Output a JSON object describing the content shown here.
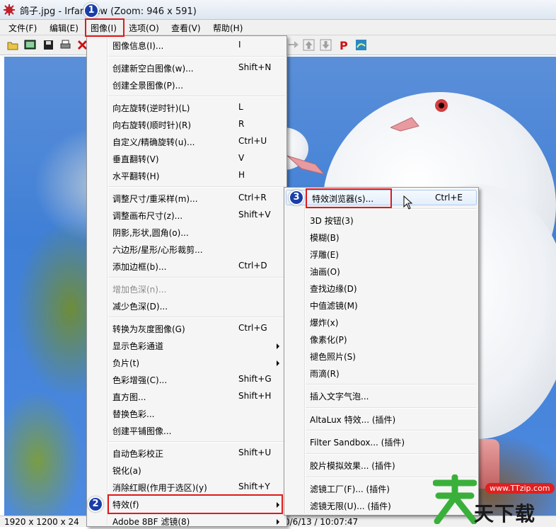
{
  "window": {
    "title": "鸽子.jpg - IrfanView (Zoom: 946 x 591)"
  },
  "menubar": {
    "items": [
      "文件(F)",
      "编辑(E)",
      "图像(I)",
      "选项(O)",
      "查看(V)",
      "帮助(H)"
    ]
  },
  "image_menu": {
    "items": [
      {
        "label": "图像信息(I)...",
        "shortcut": "I"
      },
      {
        "label": "创建新空白图像(w)...",
        "shortcut": "Shift+N"
      },
      {
        "label": "创建全景图像(P)...",
        "shortcut": ""
      },
      {
        "label": "向左旋转(逆时针)(L)",
        "shortcut": "L"
      },
      {
        "label": "向右旋转(顺时针)(R)",
        "shortcut": "R"
      },
      {
        "label": "自定义/精确旋转(u)...",
        "shortcut": "Ctrl+U"
      },
      {
        "label": "垂直翻转(V)",
        "shortcut": "V"
      },
      {
        "label": "水平翻转(H)",
        "shortcut": "H"
      },
      {
        "label": "调整尺寸/重采样(m)...",
        "shortcut": "Ctrl+R"
      },
      {
        "label": "调整画布尺寸(z)...",
        "shortcut": "Shift+V"
      },
      {
        "label": "阴影,形状,圆角(o)...",
        "shortcut": ""
      },
      {
        "label": "六边形/星形/心形裁剪...",
        "shortcut": ""
      },
      {
        "label": "添加边框(b)...",
        "shortcut": "Ctrl+D"
      },
      {
        "label": "增加色深(n)...",
        "shortcut": ""
      },
      {
        "label": "减少色深(D)...",
        "shortcut": ""
      },
      {
        "label": "转换为灰度图像(G)",
        "shortcut": "Ctrl+G"
      },
      {
        "label": "显示色彩通道",
        "shortcut": ""
      },
      {
        "label": "负片(t)",
        "shortcut": ""
      },
      {
        "label": "色彩增强(C)...",
        "shortcut": "Shift+G"
      },
      {
        "label": "直方图...",
        "shortcut": "Shift+H"
      },
      {
        "label": "替换色彩...",
        "shortcut": ""
      },
      {
        "label": "创建平铺图像...",
        "shortcut": ""
      },
      {
        "label": "自动色彩校正",
        "shortcut": "Shift+U"
      },
      {
        "label": "锐化(a)",
        "shortcut": ""
      },
      {
        "label": "消除红眼(作用于选区)(y)",
        "shortcut": "Shift+Y"
      },
      {
        "label": "特效(f)",
        "shortcut": ""
      },
      {
        "label": "Adobe 8BF 滤镜(8)",
        "shortcut": ""
      }
    ]
  },
  "effects_menu": {
    "items": [
      {
        "label": "特效浏览器(s)...",
        "shortcut": "Ctrl+E"
      },
      {
        "label": "3D 按钮(3)"
      },
      {
        "label": "模糊(B)"
      },
      {
        "label": "浮雕(E)"
      },
      {
        "label": "油画(O)"
      },
      {
        "label": "查找边缘(D)"
      },
      {
        "label": "中值滤镜(M)"
      },
      {
        "label": "爆炸(x)"
      },
      {
        "label": "像素化(P)"
      },
      {
        "label": "褪色照片(S)"
      },
      {
        "label": "雨滴(R)"
      },
      {
        "label": "插入文字气泡..."
      },
      {
        "label": "AltaLux 特效... (插件)"
      },
      {
        "label": "Filter Sandbox... (插件)"
      },
      {
        "label": "胶片模拟效果... (插件)"
      },
      {
        "label": "滤镜工厂(F)... (插件)"
      },
      {
        "label": "滤镜无限(U)... (插件)"
      }
    ]
  },
  "status": {
    "left": "1920 x 1200 x 24",
    "right": "0/6/13 / 10:07:47"
  },
  "badges": [
    "1",
    "2",
    "3"
  ],
  "watermark": {
    "url": "www.TTzip.com",
    "text": "天下载"
  },
  "colors": {
    "highlight": "#e01a1a",
    "badge": "#1a3ea8"
  }
}
